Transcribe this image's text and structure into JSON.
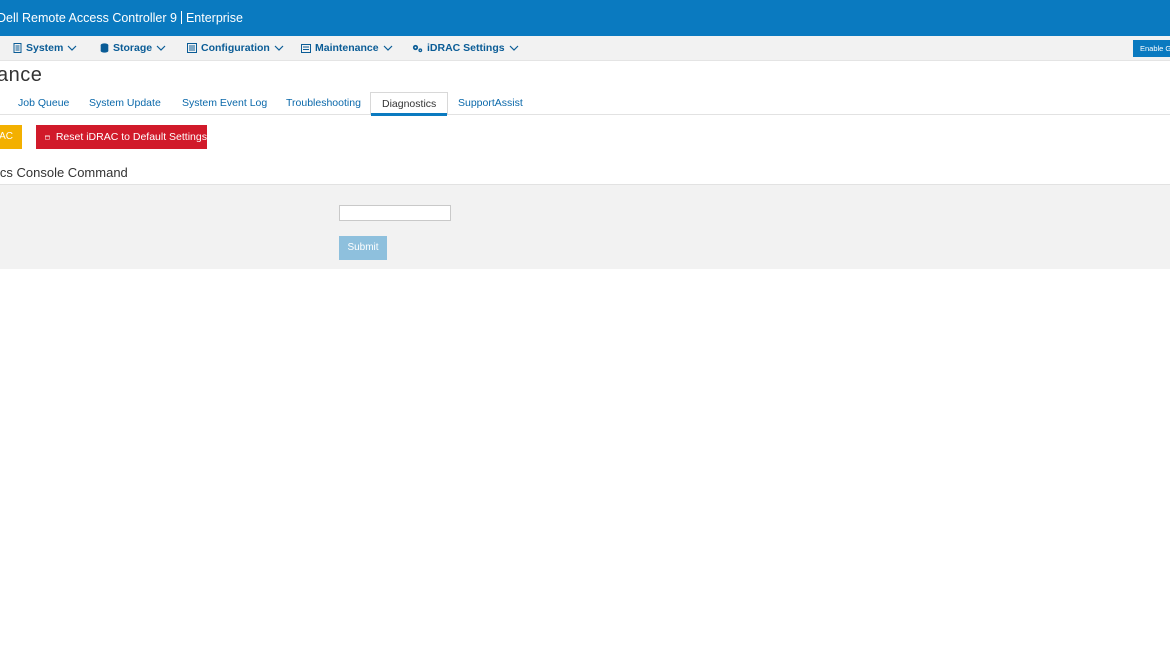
{
  "header": {
    "app_title": "Dell Remote Access Controller 9",
    "edition": "Enterprise"
  },
  "menu": {
    "items": [
      {
        "label": "System",
        "icon": "server-icon"
      },
      {
        "label": "Storage",
        "icon": "database-icon"
      },
      {
        "label": "Configuration",
        "icon": "config-icon"
      },
      {
        "label": "Maintenance",
        "icon": "list-icon"
      },
      {
        "label": "iDRAC Settings",
        "icon": "gears-icon"
      }
    ],
    "enable_button": "Enable G"
  },
  "page": {
    "title": "ance"
  },
  "tabs": [
    {
      "label": "Job Queue"
    },
    {
      "label": "System Update"
    },
    {
      "label": "System Event Log"
    },
    {
      "label": "Troubleshooting"
    },
    {
      "label": "Diagnostics",
      "active": true
    },
    {
      "label": "SupportAssist"
    }
  ],
  "actions": {
    "yellow_button": "AC",
    "reset_button": "Reset iDRAC to Default Settings"
  },
  "section": {
    "title": "ics Console Command",
    "command_value": "",
    "submit_label": "Submit"
  },
  "colors": {
    "brand_blue": "#0a7ac0",
    "danger_red": "#d11a2a",
    "warning_yellow": "#f3b000",
    "submit_disabled": "#8ec0dd"
  }
}
